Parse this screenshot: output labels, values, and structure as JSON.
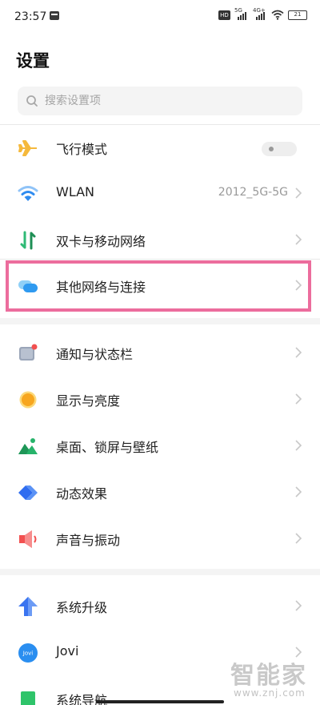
{
  "status_bar": {
    "time": "23:57",
    "hd_label": "HD",
    "sim1_label": "5G",
    "sim2_label": "4G+",
    "battery": "21"
  },
  "page_title": "设置",
  "search": {
    "placeholder": "搜索设置项"
  },
  "groups": [
    {
      "items": [
        {
          "label": "飞行模式",
          "icon": "airplane-icon",
          "control": "toggle",
          "toggle_on": false
        },
        {
          "label": "WLAN",
          "icon": "wifi-icon",
          "value": "2012_5G-5G",
          "control": "chevron"
        },
        {
          "label": "双卡与移动网络",
          "icon": "dual-sim-icon",
          "control": "chevron"
        }
      ]
    },
    {
      "items": [
        {
          "label": "其他网络与连接",
          "icon": "connection-icon",
          "control": "chevron",
          "highlighted": true
        }
      ]
    },
    {
      "items": [
        {
          "label": "通知与状态栏",
          "icon": "notification-icon",
          "control": "chevron"
        },
        {
          "label": "显示与亮度",
          "icon": "brightness-icon",
          "control": "chevron"
        },
        {
          "label": "桌面、锁屏与壁纸",
          "icon": "wallpaper-icon",
          "control": "chevron"
        },
        {
          "label": "动态效果",
          "icon": "motion-icon",
          "control": "chevron"
        },
        {
          "label": "声音与振动",
          "icon": "sound-icon",
          "control": "chevron"
        }
      ]
    },
    {
      "items": [
        {
          "label": "系统升级",
          "icon": "upgrade-icon",
          "control": "chevron"
        },
        {
          "label": "Jovi",
          "icon": "jovi-icon",
          "icon_text": "Jovi",
          "control": "chevron"
        },
        {
          "label": "系统导航",
          "icon": "navigation-icon",
          "control": "chevron"
        }
      ]
    }
  ],
  "colors": {
    "highlight_border": "#ec6d9d",
    "airplane": "#f5b93c",
    "wifi": "#2f8cf0",
    "dual_sim": "#2fba75",
    "connection": "#2f9af0",
    "brightness": "#f7a61f",
    "motion": "#2f6df0",
    "sound": "#f25050",
    "upgrade": "#3a74f0",
    "navigation": "#2fc46a"
  },
  "watermark": {
    "logo": "智能家",
    "url": "www.znj.com"
  }
}
